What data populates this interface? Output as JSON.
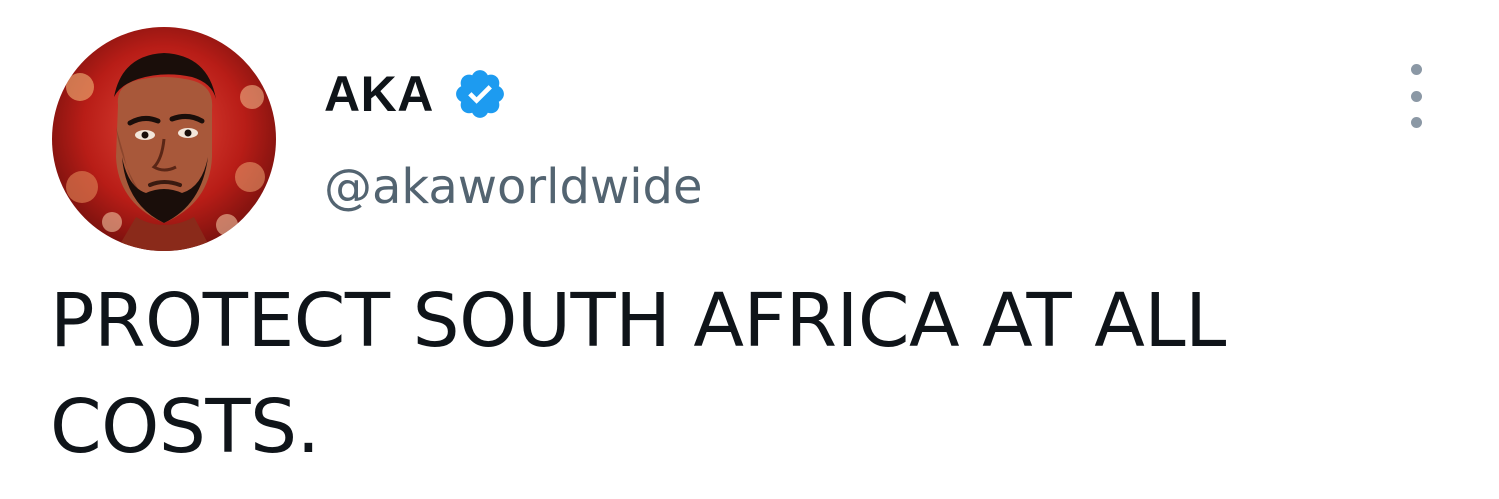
{
  "tweet": {
    "author": {
      "display_name": "AKA",
      "handle": "@akaworldwide",
      "verified": true,
      "avatar_icon": "profile-illustration-icon",
      "verified_icon": "verified-badge-icon"
    },
    "text": "PROTECT SOUTH AFRICA AT ALL COSTS.",
    "more_icon": "vertical-ellipsis-icon"
  },
  "colors": {
    "verified_blue": "#1d9bf0",
    "handle_gray": "#536471",
    "text_black": "#0f1419",
    "avatar_red": "#c0221c"
  }
}
